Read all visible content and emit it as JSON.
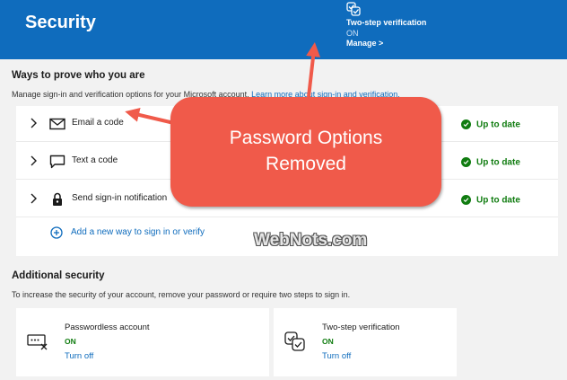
{
  "header": {
    "title": "Security",
    "two_step": {
      "title": "Two-step verification",
      "status": "ON",
      "link": "Manage >"
    }
  },
  "ways": {
    "title": "Ways to prove who you are",
    "desc": "Manage sign-in and verification options for your Microsoft account.",
    "desc_link": "Learn more about sign-in and verification.",
    "methods": [
      {
        "label": "Email a code",
        "icon": "envelope-icon",
        "status": "Up to date"
      },
      {
        "label": "Text a code",
        "icon": "chat-icon",
        "status": "Up to date"
      },
      {
        "label": "Send sign-in notification",
        "icon": "lock-icon",
        "status": "Up to date"
      }
    ],
    "add_label": "Add a new way to sign in or verify"
  },
  "additional": {
    "title": "Additional security",
    "desc": "To increase the security of your account, remove your password or require two steps to sign in.",
    "cards": [
      {
        "title": "Passwordless account",
        "status": "ON",
        "link": "Turn off",
        "icon": "password-off-icon"
      },
      {
        "title": "Two-step verification",
        "status": "ON",
        "link": "Turn off",
        "icon": "two-step-icon"
      }
    ]
  },
  "callout": {
    "line1": "Password Options",
    "line2": "Removed"
  },
  "watermark": "WebNots.com",
  "colors": {
    "header_bg": "#0f6cbd",
    "success": "#107c10",
    "link": "#0f6cbd",
    "callout": "#f05a4a"
  }
}
